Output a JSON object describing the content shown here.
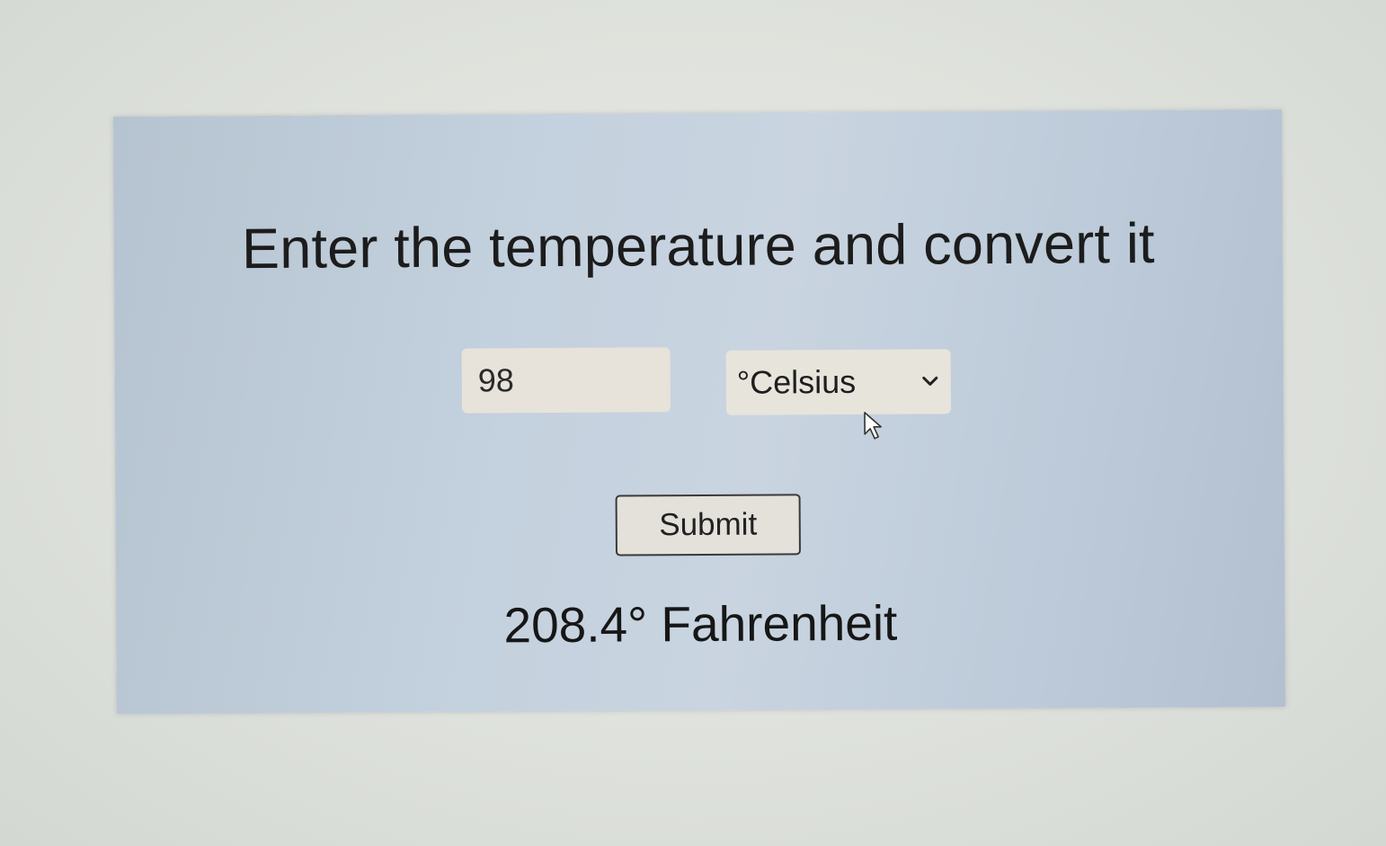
{
  "page": {
    "title": "Enter the temperature and convert it"
  },
  "form": {
    "temperature_value": "98",
    "unit_selected": "°Celsius",
    "submit_label": "Submit"
  },
  "result": {
    "text": "208.4° Fahrenheit"
  },
  "icons": {
    "select_arrow": "chevron-down-icon",
    "pointer": "mouse-pointer-icon"
  },
  "colors": {
    "panel_background": "#c4d1de",
    "input_background": "#e7e3da",
    "button_border": "#3a3a3a",
    "text": "#1c1c1c"
  }
}
